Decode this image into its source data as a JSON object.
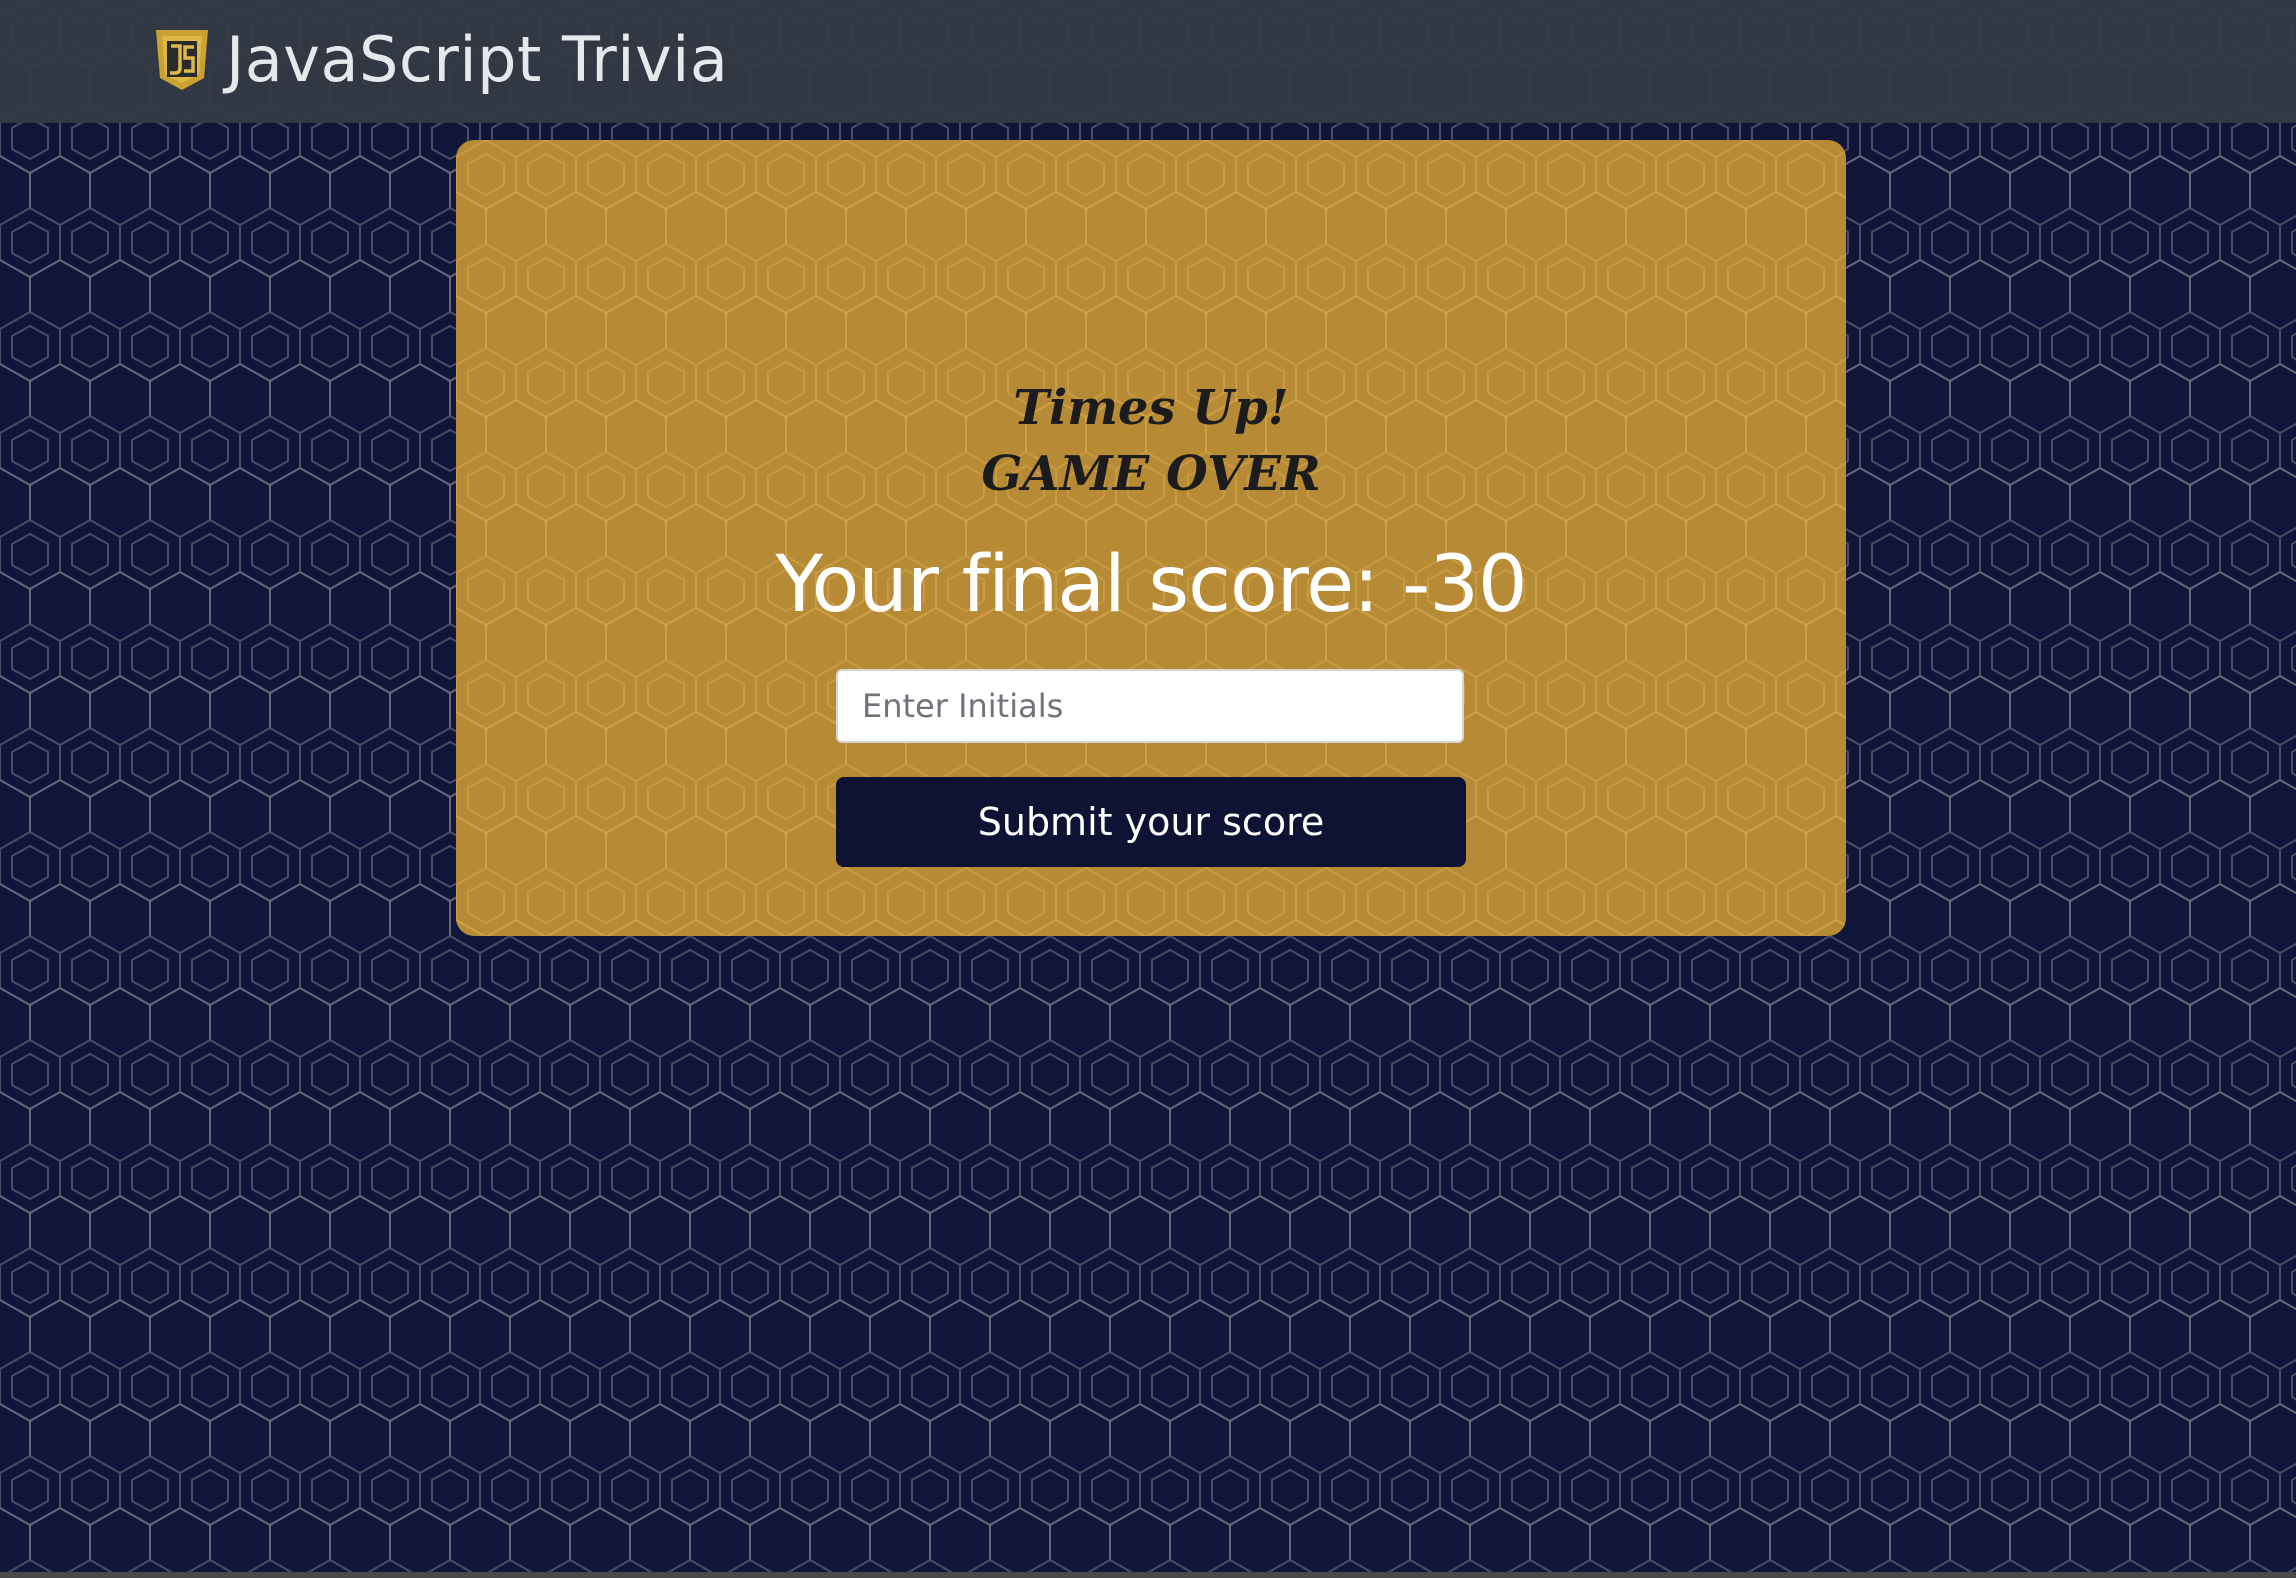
{
  "header": {
    "logo_icon": "js-shield-icon",
    "title": "JavaScript Trivia"
  },
  "game": {
    "times_up": "Times Up!",
    "game_over": "GAME OVER",
    "final_score_label": "Your final score: -30",
    "initials_placeholder": "Enter Initials",
    "initials_value": "",
    "submit_label": "Submit your score"
  },
  "colors": {
    "page_background": "#10163a",
    "header_background": "#343a44",
    "card_background": "#b78a36",
    "button_background": "#0e1333",
    "logo_gold": "#c9a232"
  }
}
